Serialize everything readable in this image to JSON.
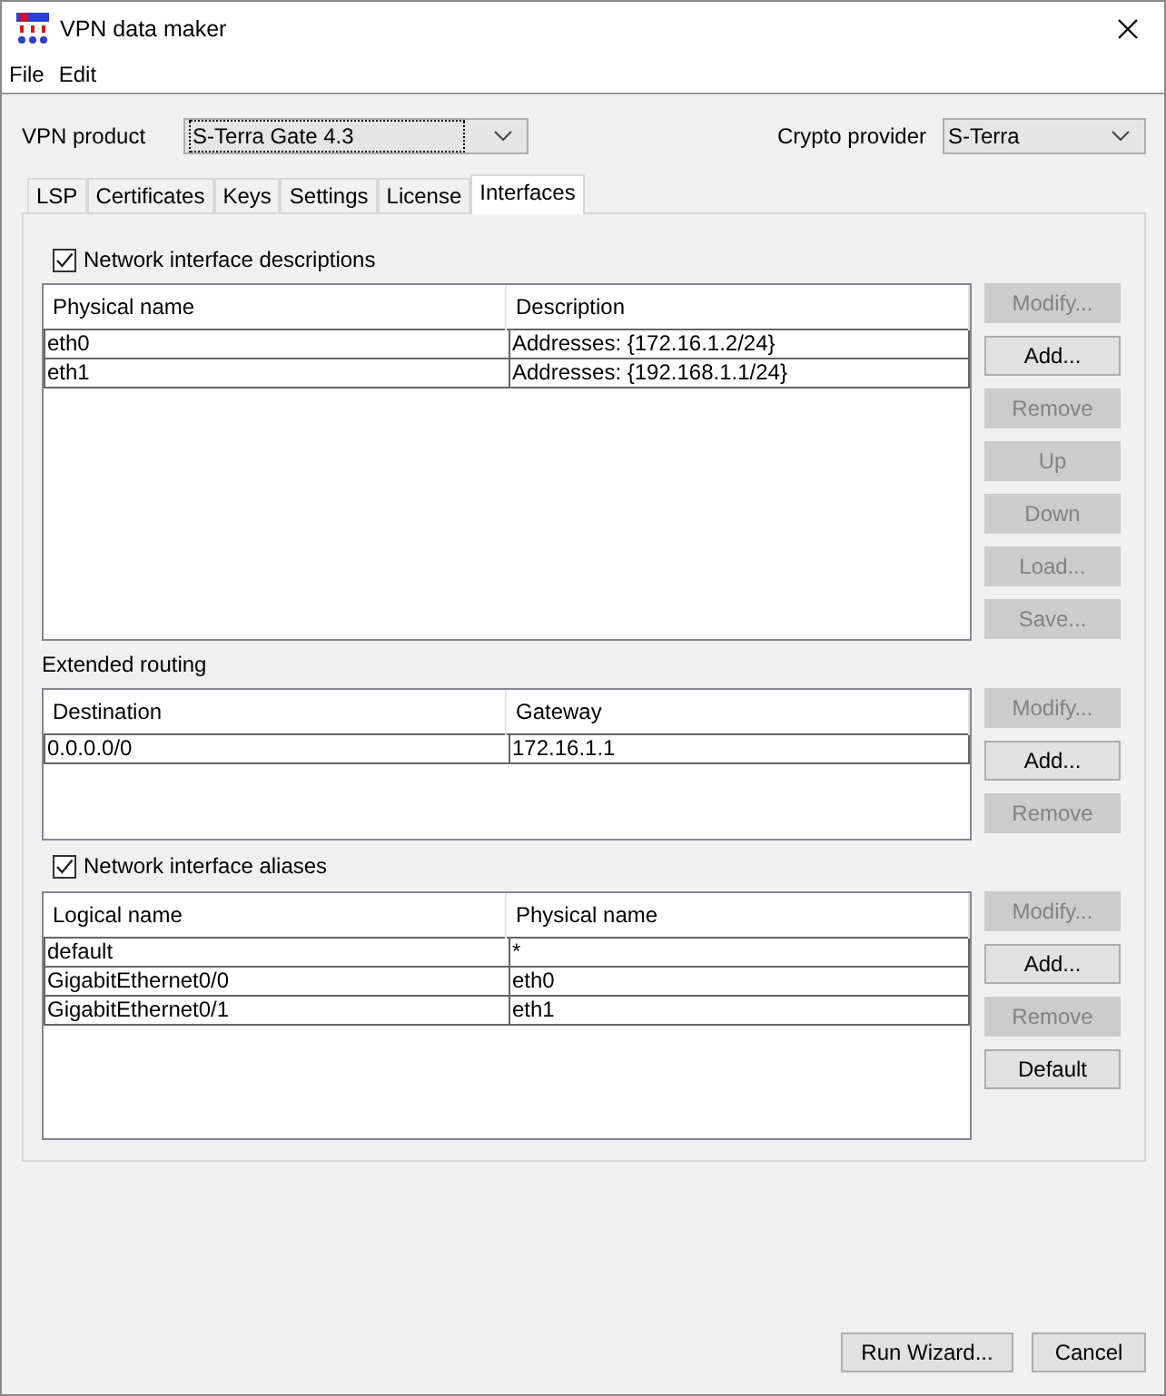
{
  "window": {
    "title": "VPN data maker"
  },
  "menu": [
    "File",
    "Edit"
  ],
  "vpn_product": {
    "label": "VPN product",
    "value": "S-Terra Gate 4.3"
  },
  "crypto_provider": {
    "label": "Crypto provider",
    "value": "S-Terra"
  },
  "tabs": [
    {
      "label": "LSP",
      "selected": false
    },
    {
      "label": "Certificates",
      "selected": false
    },
    {
      "label": "Keys",
      "selected": false
    },
    {
      "label": "Settings",
      "selected": false
    },
    {
      "label": "License",
      "selected": false
    },
    {
      "label": "Interfaces",
      "selected": true
    }
  ],
  "sections": [
    {
      "kind": "checkbox",
      "title": "Network interface descriptions",
      "checked": true,
      "columns": [
        "Physical name",
        "Description"
      ],
      "rows": [
        [
          "eth0",
          "Addresses: {172.16.1.2/24}"
        ],
        [
          "eth1",
          "Addresses: {192.168.1.1/24}"
        ]
      ],
      "buttons": [
        {
          "label": "Modify...",
          "disabled": true
        },
        {
          "label": "Add...",
          "disabled": false
        },
        {
          "label": "Remove",
          "disabled": true
        },
        {
          "label": "Up",
          "disabled": true
        },
        {
          "label": "Down",
          "disabled": true
        },
        {
          "label": "Load...",
          "disabled": true
        },
        {
          "label": "Save...",
          "disabled": true
        }
      ]
    },
    {
      "kind": "label",
      "title": "Extended routing",
      "columns": [
        "Destination",
        "Gateway"
      ],
      "rows": [
        [
          "0.0.0.0/0",
          "172.16.1.1"
        ]
      ],
      "buttons": [
        {
          "label": "Modify...",
          "disabled": true
        },
        {
          "label": "Add...",
          "disabled": false
        },
        {
          "label": "Remove",
          "disabled": true
        }
      ]
    },
    {
      "kind": "checkbox",
      "title": "Network interface aliases",
      "checked": true,
      "columns": [
        "Logical name",
        "Physical name"
      ],
      "rows": [
        [
          "default",
          "*"
        ],
        [
          "GigabitEthernet0/0",
          "eth0"
        ],
        [
          "GigabitEthernet0/1",
          "eth1"
        ]
      ],
      "buttons": [
        {
          "label": "Modify...",
          "disabled": true
        },
        {
          "label": "Add...",
          "disabled": false
        },
        {
          "label": "Remove",
          "disabled": true
        },
        {
          "label": "Default",
          "disabled": false
        }
      ]
    }
  ],
  "footer_buttons": [
    "Run Wizard...",
    "Cancel"
  ]
}
